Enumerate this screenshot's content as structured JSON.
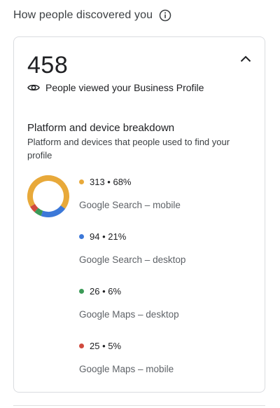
{
  "header": {
    "title": "How people discovered you",
    "info_icon": "info-icon"
  },
  "card": {
    "total_views": "458",
    "views_label": "People viewed your Business Profile",
    "collapse_icon": "chevron-up-icon",
    "breakdown": {
      "title": "Platform and device breakdown",
      "subtitle": "Platform and devices that people used to find your profile",
      "items": [
        {
          "value_text": "313 • 68%",
          "label": "Google Search – mobile",
          "count": 313,
          "percent": 68,
          "color": "#e8a93a"
        },
        {
          "value_text": "94 • 21%",
          "label": "Google Search – desktop",
          "count": 94,
          "percent": 21,
          "color": "#3c78d8"
        },
        {
          "value_text": "26 • 6%",
          "label": "Google Maps – desktop",
          "count": 26,
          "percent": 6,
          "color": "#3b9a57"
        },
        {
          "value_text": "25 • 5%",
          "label": "Google Maps – mobile",
          "count": 25,
          "percent": 5,
          "color": "#d04a3e"
        }
      ]
    }
  }
}
